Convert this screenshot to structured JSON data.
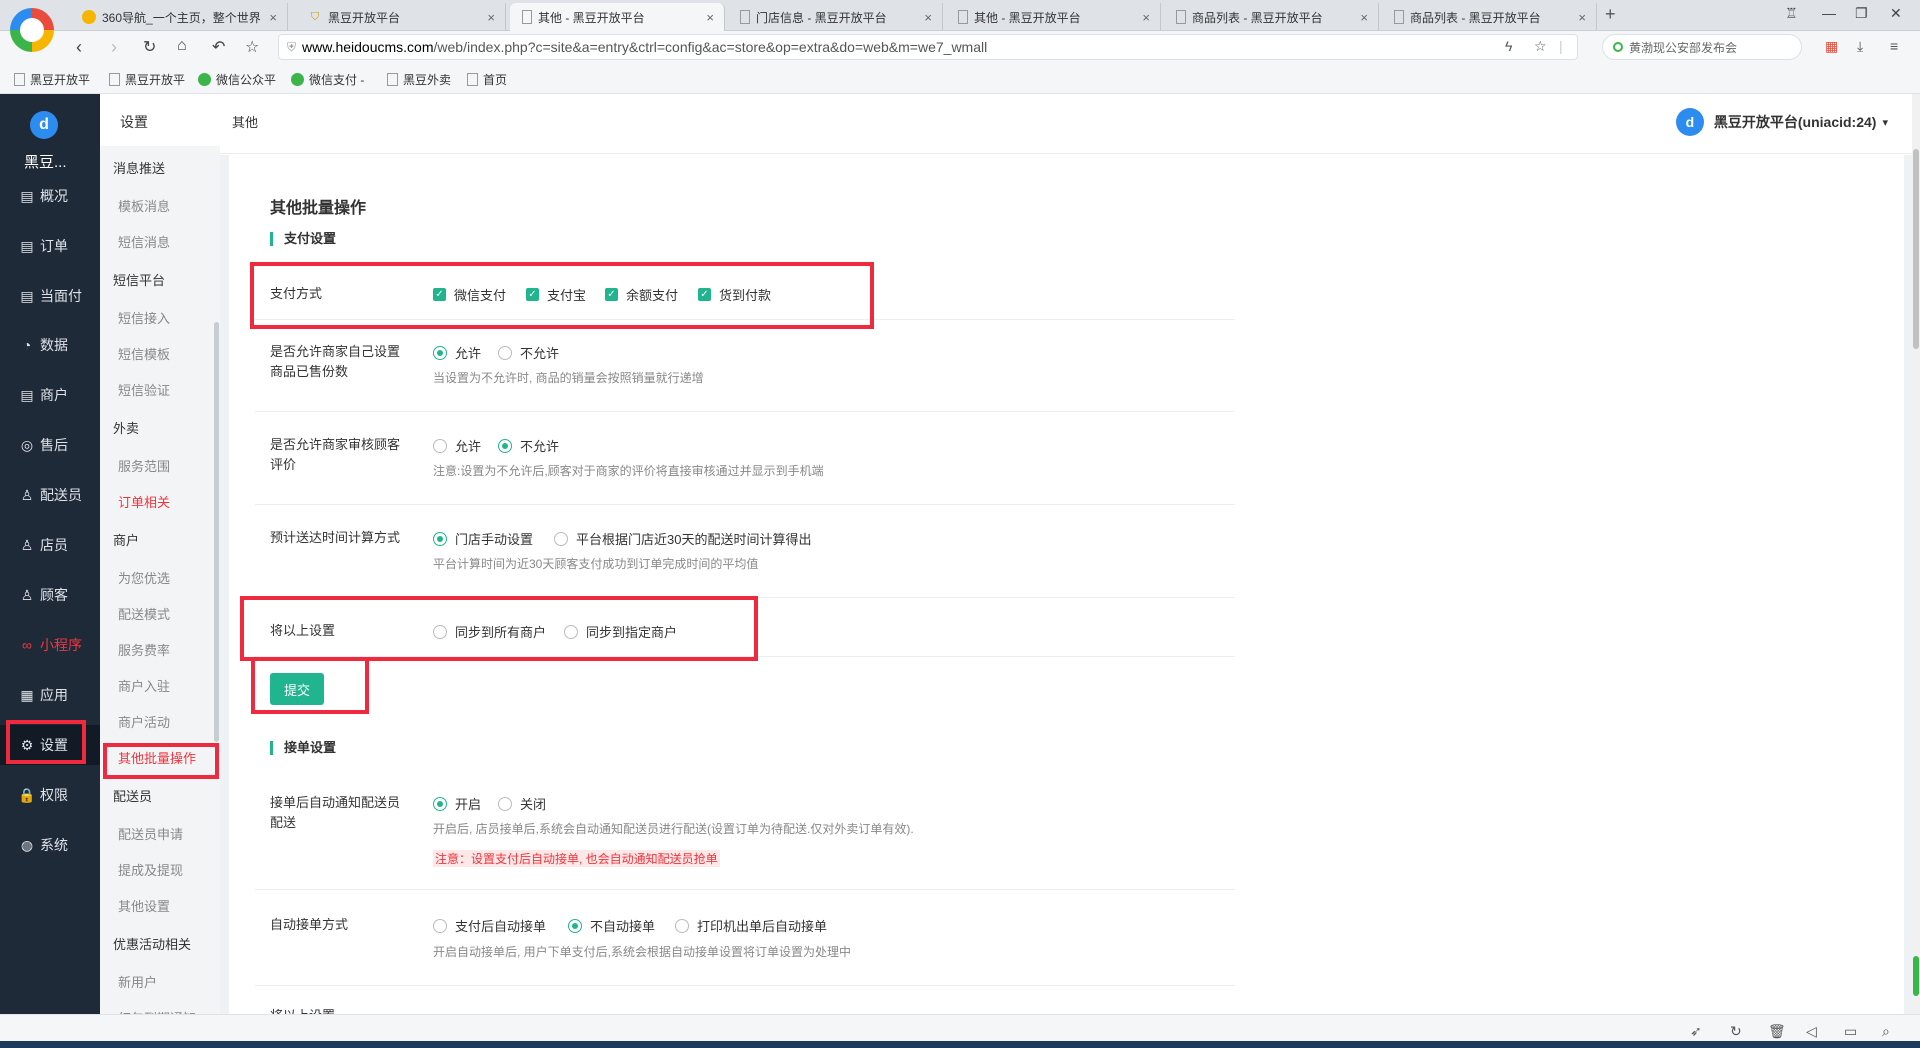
{
  "browser": {
    "tabs": [
      {
        "title": "360导航_一个主页，整个世界",
        "close": "×"
      },
      {
        "title": "黑豆开放平台",
        "close": "×"
      },
      {
        "title": "其他 - 黑豆开放平台",
        "close": "×"
      },
      {
        "title": "门店信息 - 黑豆开放平台",
        "close": "×"
      },
      {
        "title": "其他 - 黑豆开放平台",
        "close": "×"
      },
      {
        "title": "商品列表 - 黑豆开放平台",
        "close": "×"
      },
      {
        "title": "商品列表 - 黑豆开放平台",
        "close": "×"
      }
    ],
    "new_tab": "+",
    "url_host": "www.heidoucms.com",
    "url_path": "/web/index.php?c=site&a=entry&ctrl=config&ac=store&op=extra&do=web&m=we7_wmall",
    "search_placeholder": "黄渤现公安部发布会",
    "bookmarks": [
      "黑豆开放平",
      "黑豆开放平",
      "微信公众平",
      "微信支付 -",
      "黑豆外卖",
      "首页"
    ]
  },
  "nav": {
    "brand": "黑豆...",
    "items": [
      {
        "label": "概况",
        "icon": "▤"
      },
      {
        "label": "订单",
        "icon": "▤"
      },
      {
        "label": "当面付",
        "icon": "▤"
      },
      {
        "label": "数据",
        "icon": "◔"
      },
      {
        "label": "商户",
        "icon": "▤"
      },
      {
        "label": "售后",
        "icon": "◎"
      },
      {
        "label": "配送员",
        "icon": "♙"
      },
      {
        "label": "店员",
        "icon": "♙"
      },
      {
        "label": "顾客",
        "icon": "♙"
      },
      {
        "label": "小程序",
        "icon": "∞"
      },
      {
        "label": "应用",
        "icon": "▦"
      },
      {
        "label": "设置",
        "icon": "⚙"
      },
      {
        "label": "权限",
        "icon": "🔒"
      },
      {
        "label": "系统",
        "icon": "◍"
      }
    ]
  },
  "subnav": {
    "title": "设置",
    "groups": [
      "消息推送",
      "短信平台",
      "外卖",
      "商户",
      "配送员",
      "优惠活动相关"
    ],
    "items": {
      "msg": [
        "模板消息",
        "短信消息"
      ],
      "sms": [
        "短信接入",
        "短信模板",
        "短信验证"
      ],
      "takeout": [
        "服务范围",
        "订单相关"
      ],
      "merchant": [
        "为您优选",
        "配送模式",
        "服务费率",
        "商户入驻",
        "商户活动",
        "其他批量操作"
      ],
      "rider": [
        "配送员申请",
        "提成及提现",
        "其他设置"
      ],
      "promo": [
        "新用户",
        "红包到期通知"
      ]
    }
  },
  "header": {
    "breadcrumb": "其他",
    "user": "黑豆开放平台(uniacid:24)",
    "user_caret": "▾"
  },
  "page": {
    "title": "其他批量操作",
    "section_pay": "支付设置",
    "section_order": "接单设置",
    "pay_methods": {
      "label": "支付方式",
      "options": [
        "微信支付",
        "支付宝",
        "余额支付",
        "货到付款"
      ]
    },
    "sales_count": {
      "label": "是否允许商家自己设置商品已售份数",
      "options": [
        "允许",
        "不允许"
      ],
      "selected": "允许",
      "help": "当设置为不允许时, 商品的销量会按照销量就行递增"
    },
    "review": {
      "label": "是否允许商家审核顾客评价",
      "options": [
        "允许",
        "不允许"
      ],
      "selected": "不允许",
      "help": "注意:设置为不允许后,顾客对于商家的评价将直接审核通过并显示到手机端"
    },
    "delivery_time": {
      "label": "预计送达时间计算方式",
      "options": [
        "门店手动设置",
        "平台根据门店近30天的配送时间计算得出"
      ],
      "selected": "门店手动设置",
      "help": "平台计算时间为近30天顾客支付成功到订单完成时间的平均值"
    },
    "sync": {
      "label": "将以上设置",
      "options": [
        "同步到所有商户",
        "同步到指定商户"
      ]
    },
    "submit": "提交",
    "auto_notify": {
      "label": "接单后自动通知配送员配送",
      "options": [
        "开启",
        "关闭"
      ],
      "selected": "开启",
      "help": "开启后, 店员接单后,系统会自动通知配送员进行配送(设置订单为待配送.仅对外卖订单有效).",
      "warning": "注意：设置支付后自动接单, 也会自动通知配送员抢单"
    },
    "auto_accept": {
      "label": "自动接单方式",
      "options": [
        "支付后自动接单",
        "不自动接单",
        "打印机出单后自动接单"
      ],
      "selected": "不自动接单",
      "help": "开启自动接单后, 用户下单支付后,系统会根据自动接单设置将订单设置为处理中"
    },
    "cut_label": "将以上设置"
  },
  "colors": {
    "accent": "#20b58f",
    "highlight": "#ef2a3f",
    "nav_bg": "#1f2a38"
  }
}
